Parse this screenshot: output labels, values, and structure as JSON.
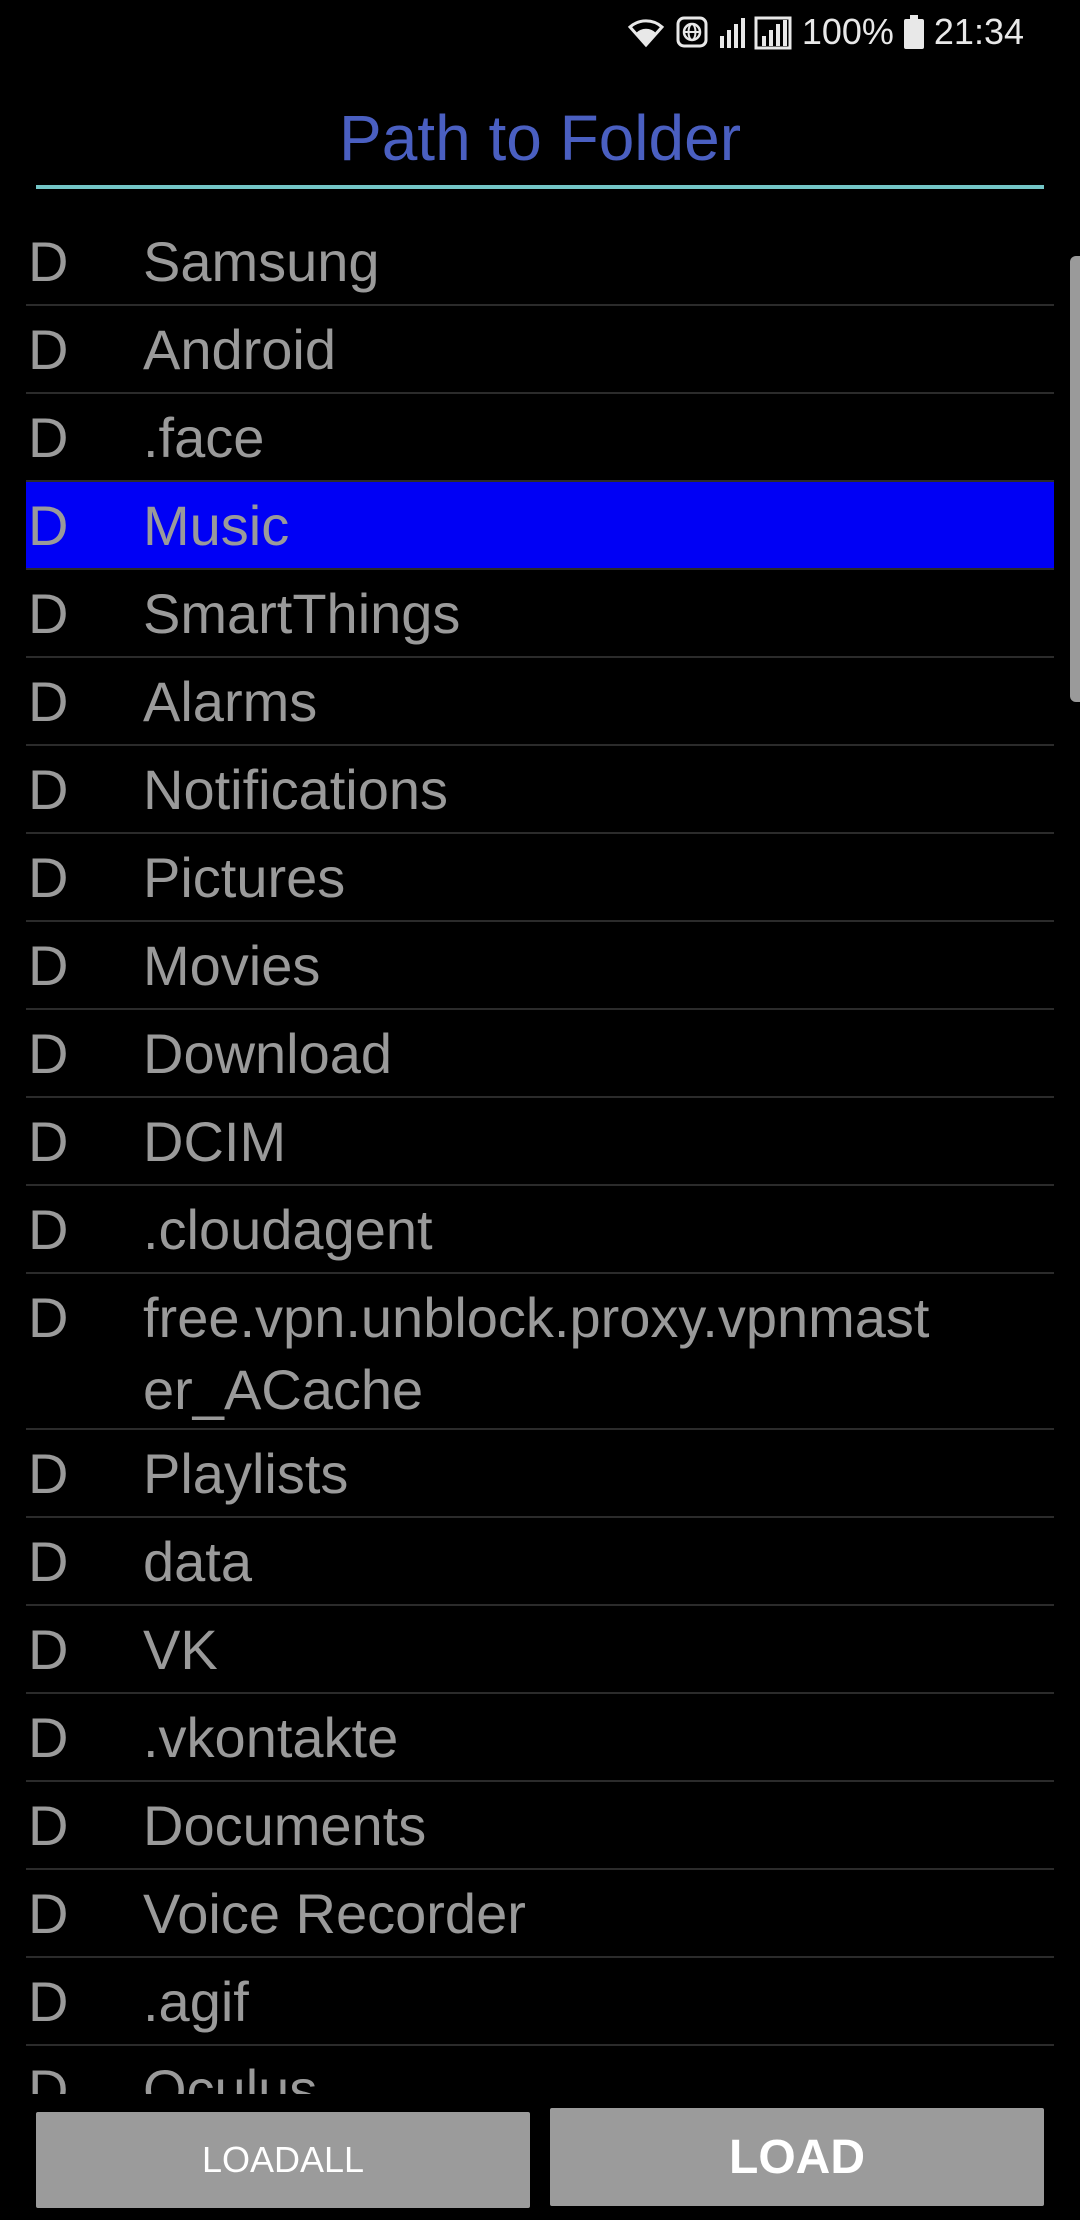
{
  "status_bar": {
    "battery": "100%",
    "time": "21:34",
    "icons": [
      "wifi-icon",
      "vpn-globe-icon",
      "signal-icon",
      "battery-icon"
    ]
  },
  "header": {
    "title": "Path to Folder"
  },
  "list": {
    "items": [
      {
        "type": "D",
        "name": "Samsung"
      },
      {
        "type": "D",
        "name": "Android"
      },
      {
        "type": "D",
        "name": ".face"
      },
      {
        "type": "D",
        "name": "Music",
        "selected": true
      },
      {
        "type": "D",
        "name": "SmartThings"
      },
      {
        "type": "D",
        "name": "Alarms"
      },
      {
        "type": "D",
        "name": "Notifications"
      },
      {
        "type": "D",
        "name": "Pictures"
      },
      {
        "type": "D",
        "name": "Movies"
      },
      {
        "type": "D",
        "name": "Download"
      },
      {
        "type": "D",
        "name": "DCIM"
      },
      {
        "type": "D",
        "name": ".cloudagent"
      },
      {
        "type": "D",
        "name": "free.vpn.unblock.proxy.vpnmaster_ACache"
      },
      {
        "type": "D",
        "name": "Playlists"
      },
      {
        "type": "D",
        "name": "data"
      },
      {
        "type": "D",
        "name": "VK"
      },
      {
        "type": "D",
        "name": ".vkontakte"
      },
      {
        "type": "D",
        "name": "Documents"
      },
      {
        "type": "D",
        "name": "Voice Recorder"
      },
      {
        "type": "D",
        "name": ".agif"
      },
      {
        "type": "D",
        "name": "Oculus"
      }
    ]
  },
  "buttons": {
    "loadall_label": "LOADALL",
    "load_label": "LOAD"
  },
  "colors": {
    "title": "#4a5fc1",
    "title_rule": "#74c6c7",
    "selection": "#0000f5",
    "button_bg": "#9b9b9b",
    "list_text": "#9a9a9a"
  }
}
